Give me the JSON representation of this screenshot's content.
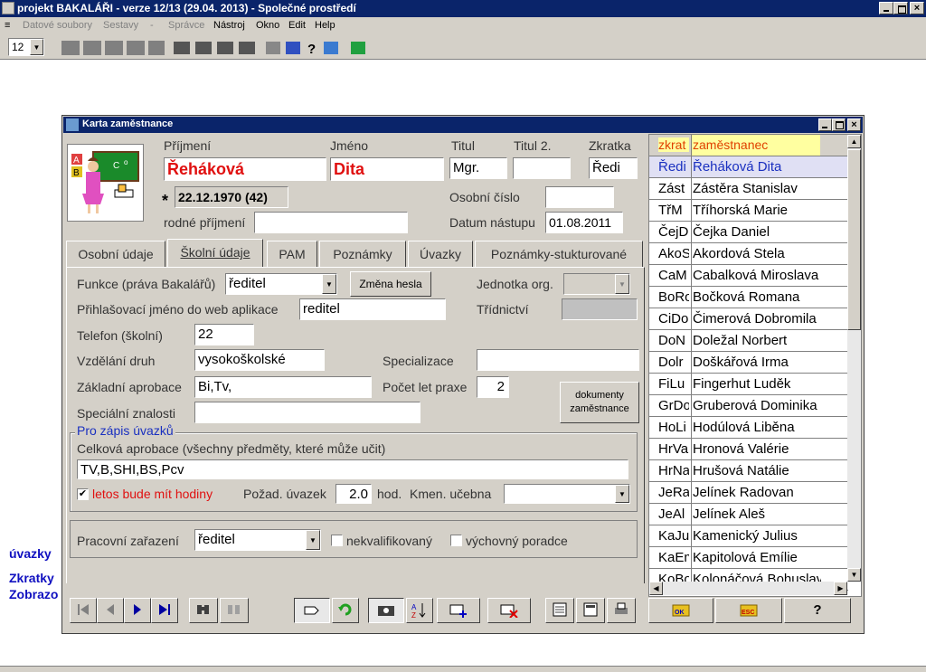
{
  "app": {
    "title": "projekt BAKALÁŘI  - verze 12/13 (29.04. 2013)  - Společné prostředí"
  },
  "menu": [
    "Datové soubory",
    "Sestavy",
    "-",
    "Správce",
    "Nástroj",
    "Okno",
    "Edit",
    "Help"
  ],
  "toolbar": {
    "zoom_value": "12"
  },
  "window": {
    "title": "Karta zaměstnance"
  },
  "header": {
    "prijmeni_label": "Příjmení",
    "prijmeni": "Řeháková",
    "jmeno_label": "Jméno",
    "jmeno": "Dita",
    "titul_label": "Titul",
    "titul": "Mgr.",
    "titul2_label": "Titul 2.",
    "titul2": "",
    "zkratka_label": "Zkratka",
    "zkratka": "Ředi",
    "birth_star": "*",
    "birth": "22.12.1970 (42)",
    "osobni_cislo_label": "Osobní číslo",
    "osobni_cislo": "",
    "rodne_prijmeni_label": "rodné příjmení",
    "rodne_prijmeni": "",
    "datum_nastupu_label": "Datum nástupu",
    "datum_nastupu": "01.08.2011"
  },
  "tabs": [
    "Osobní údaje",
    "Školní údaje",
    "PAM",
    "Poznámky",
    "Úvazky",
    "Poznámky-stukturované"
  ],
  "form": {
    "funkce_label": "Funkce (práva Bakalářů)",
    "funkce": "ředitel",
    "zmena_hesla": "Změna hesla",
    "jednotka_label": "Jednotka org.",
    "jednotka": "",
    "login_label": "Přihlašovací jméno do web aplikace",
    "login": "reditel",
    "tridnictvi_label": "Třídnictví",
    "tridnictvi": "",
    "telefon_label": "Telefon (školní)",
    "telefon": "22",
    "vzdelani_label": "Vzdělání druh",
    "vzdelani": "vysokoškolské",
    "specializace_label": "Specializace",
    "specializace": "",
    "aprobace_label": "Základní aprobace",
    "aprobace": "Bi,Tv,",
    "pocet_let_label": "Počet let praxe",
    "pocet_let": "2",
    "dokumenty_line1": "dokumenty",
    "dokumenty_line2": "zaměstnance",
    "znalosti_label": "Speciální znalosti",
    "znalosti": "",
    "group_title": "Pro zápis úvazků",
    "celkova_label": "Celková aprobace (všechny předměty, které může učit)",
    "celkova": "TV,B,SHI,BS,Pcv",
    "letos_check": "✔",
    "letos_label": "letos bude mít hodiny",
    "uvazek_label": "Požad. úvazek",
    "uvazek": "2.0",
    "hod_label": "hod.",
    "ucebna_label": "Kmen. učebna",
    "ucebna": "",
    "zarazeni_label": "Pracovní zařazení",
    "zarazeni": "ředitel",
    "nekval_label": "nekvalifikovaný",
    "poradce_label": "výchovný poradce"
  },
  "grid": {
    "col1": "zkrat",
    "col2": "zaměstnanec",
    "rows": [
      {
        "zk": "Ředi",
        "name": "Řeháková Dita"
      },
      {
        "zk": "Zást",
        "name": "Zástěra Stanislav"
      },
      {
        "zk": "TřM",
        "name": "Tříhorská Marie"
      },
      {
        "zk": "ČejD",
        "name": "Čejka Daniel"
      },
      {
        "zk": "AkoS",
        "name": "Akordová Stela"
      },
      {
        "zk": "CaM",
        "name": "Cabalková Miroslava"
      },
      {
        "zk": "BoRo",
        "name": "Bočková Romana"
      },
      {
        "zk": "CiDo",
        "name": "Čimerová Dobromila"
      },
      {
        "zk": "DoN",
        "name": "Doležal Norbert"
      },
      {
        "zk": "Dolr",
        "name": "Doškářová Irma"
      },
      {
        "zk": "FiLu",
        "name": "Fingerhut Luděk"
      },
      {
        "zk": "GrDo",
        "name": "Gruberová Dominika"
      },
      {
        "zk": "HoLi",
        "name": "Hodúlová Liběna"
      },
      {
        "zk": "HrVa",
        "name": "Hronová Valérie"
      },
      {
        "zk": "HrNa",
        "name": "Hrušová Natálie"
      },
      {
        "zk": "JeRa",
        "name": "Jelínek Radovan"
      },
      {
        "zk": "JeAl",
        "name": "Jelínek Aleš"
      },
      {
        "zk": "KaJu",
        "name": "Kamenický Julius"
      },
      {
        "zk": "KaEm",
        "name": "Kapitolová Emílie"
      },
      {
        "zk": "KoBo",
        "name": "Kolonáčová Bohuslava"
      }
    ]
  },
  "buttons": {
    "ok": "OK",
    "esc": "ESC",
    "help": "?"
  },
  "background_text": [
    "úvazky",
    "Zkratky",
    "Zobrazo"
  ]
}
